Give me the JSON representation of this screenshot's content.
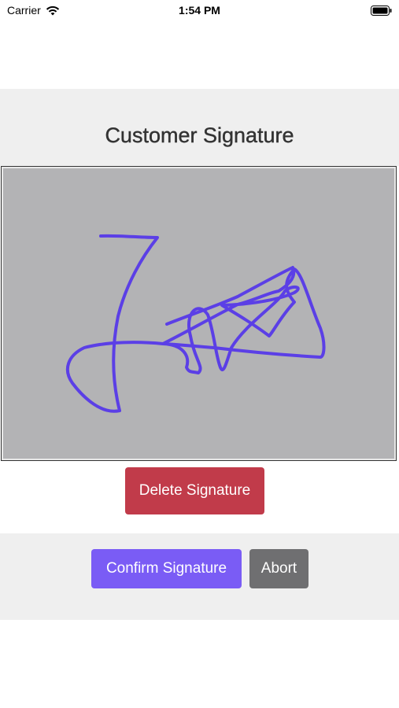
{
  "status_bar": {
    "carrier": "Carrier",
    "time": "1:54 PM"
  },
  "page": {
    "title": "Customer Signature"
  },
  "signature_pad": {
    "stroke_color": "#5b3fe6",
    "background_color": "#b3b3b5"
  },
  "actions": {
    "delete_label": "Delete Signature",
    "confirm_label": "Confirm Signature",
    "abort_label": "Abort"
  },
  "colors": {
    "delete": "#c13b4a",
    "confirm": "#7a5cf5",
    "abort": "#6f6f71",
    "band": "#efefef"
  }
}
